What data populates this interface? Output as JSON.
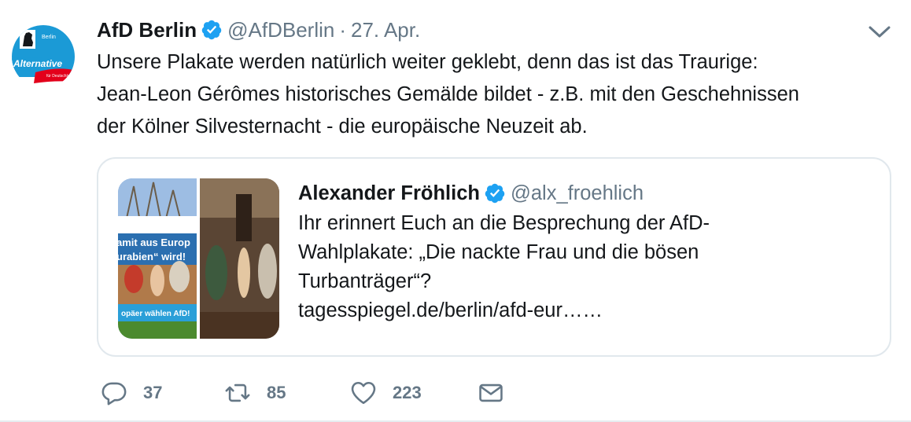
{
  "tweet": {
    "author_name": "AfD Berlin",
    "handle": "@AfDBerlin",
    "separator": "·",
    "date": "27. Apr.",
    "text_lines": [
      "Unsere Plakate werden natürlich weiter geklebt, denn das ist das Traurige:",
      "Jean-Leon Gérômes historisches Gemälde bildet - z.B. mit den Geschehnissen",
      "der Kölner Silvesternacht - die europäische Neuzeit ab."
    ],
    "avatar_logo_text": "Alternative",
    "avatar_city_text": "Berlin",
    "avatar_small_text": "für Deutschland"
  },
  "quoted": {
    "author_name": "Alexander Fröhlich",
    "handle": "@alx_froehlich",
    "text_lines": [
      "Ihr erinnert Euch an die Besprechung der AfD-",
      "Wahlplakate: „Die nackte Frau und die bösen",
      "Turbanträger“?",
      "tagesspiegel.de/berlin/afd-eur……"
    ],
    "poster_text_1": "amit aus Europ",
    "poster_text_2": "urabien“ wird!",
    "poster_text_3": "opäer wählen AfD!"
  },
  "actions": {
    "reply_count": "37",
    "retweet_count": "85",
    "like_count": "223"
  },
  "colors": {
    "verified_blue": "#1da1f2",
    "secondary_text": "#657786",
    "border": "#e1e8ed",
    "afd_blue": "#1b9ad6",
    "afd_red": "#e3001b"
  },
  "icons": [
    "verified-badge-icon",
    "chevron-down-icon",
    "reply-icon",
    "retweet-icon",
    "like-icon",
    "dm-icon"
  ]
}
